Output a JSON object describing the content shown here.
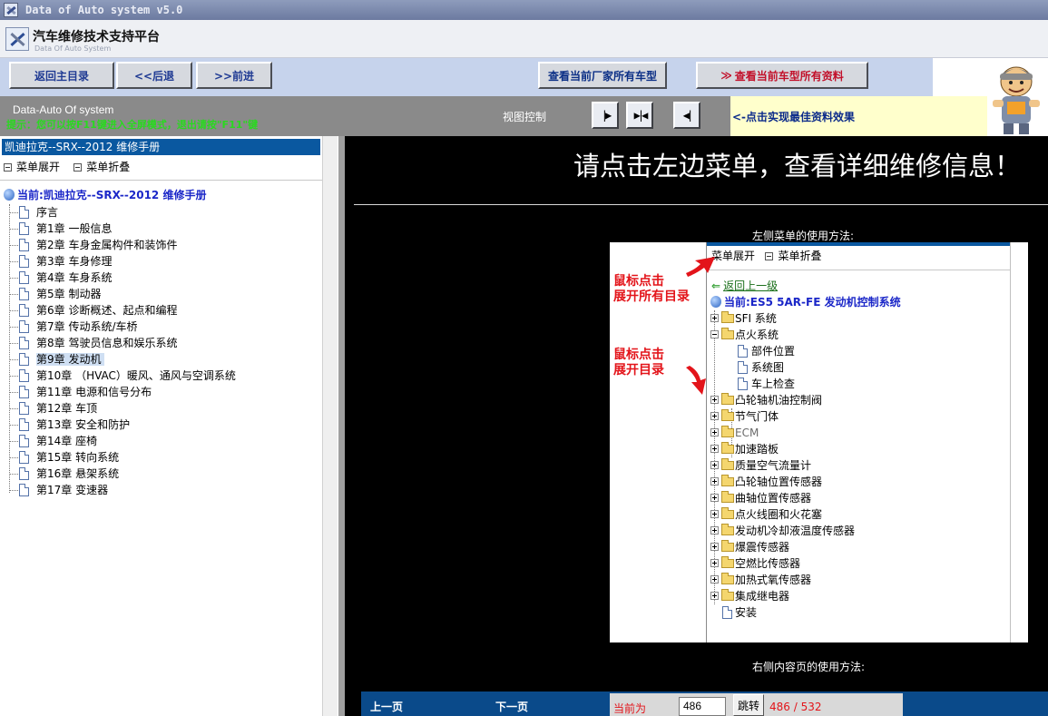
{
  "window": {
    "title": "Data of Auto system v5.0"
  },
  "header": {
    "title": "汽车维修技术支持平台",
    "subtitle": "Data Of Auto System"
  },
  "toolbar": {
    "main_menu": "返回主目录",
    "back": "<<后退",
    "forward": ">>前进",
    "all_models": "查看当前厂家所有车型",
    "all_data_prefix": "≫",
    "all_data": "查看当前车型所有资料"
  },
  "viewbar": {
    "brand": "Data-Auto Of system",
    "hint": "提示：您可以按F11键进入全屏模式，退出请按\"F11\"键",
    "view_control": "视图控制",
    "tip": "<-点击实现最佳资料效果"
  },
  "sidebar": {
    "book_title": "凯迪拉克--SRX--2012 维修手册",
    "expand": "菜单展开",
    "collapse": "菜单折叠",
    "current": "当前:凯迪拉克--SRX--2012 维修手册",
    "items": [
      {
        "label": "序言"
      },
      {
        "label": "第1章  一般信息"
      },
      {
        "label": "第2章  车身金属构件和装饰件"
      },
      {
        "label": "第3章  车身修理"
      },
      {
        "label": "第4章  车身系统"
      },
      {
        "label": "第5章  制动器"
      },
      {
        "label": "第6章  诊断概述、起点和编程"
      },
      {
        "label": "第7章  传动系统/车桥"
      },
      {
        "label": "第8章  驾驶员信息和娱乐系统"
      },
      {
        "label": "第9章  发动机",
        "selected": true
      },
      {
        "label": "第10章 （HVAC）暖风、通风与空调系统"
      },
      {
        "label": "第11章  电源和信号分布"
      },
      {
        "label": "第12章  车顶"
      },
      {
        "label": "第13章  安全和防护"
      },
      {
        "label": "第14章  座椅"
      },
      {
        "label": "第15章  转向系统"
      },
      {
        "label": "第16章  悬架系统"
      },
      {
        "label": "第17章  变速器"
      }
    ]
  },
  "main": {
    "heading": "请点击左边菜单，查看详细维修信息！",
    "left_menu_caption": "左侧菜单的使用方法:",
    "right_content_caption": "右侧内容页的使用方法:",
    "demo": {
      "expand": "菜单展开",
      "collapse": "菜单折叠",
      "up_level": "返回上一级",
      "current": "当前:ES5 5AR-FE 发动机控制系统",
      "annotation_expand_all": [
        "鼠标点击",
        "展开所有目录"
      ],
      "annotation_expand": [
        "鼠标点击",
        "展开目录"
      ],
      "tree": [
        {
          "label": "SFI 系统",
          "state": "plus"
        },
        {
          "label": "点火系统",
          "state": "minus"
        },
        {
          "label": "部件位置",
          "state": "child"
        },
        {
          "label": "系统图",
          "state": "child"
        },
        {
          "label": "车上检查",
          "state": "child"
        },
        {
          "label": "凸轮轴机油控制阀",
          "state": "plus"
        },
        {
          "label": "节气门体",
          "state": "plus"
        },
        {
          "label": "ECM",
          "state": "plus"
        },
        {
          "label": "加速踏板",
          "state": "plus"
        },
        {
          "label": "质量空气流量计",
          "state": "plus"
        },
        {
          "label": "凸轮轴位置传感器",
          "state": "plus"
        },
        {
          "label": "曲轴位置传感器",
          "state": "plus"
        },
        {
          "label": "点火线圈和火花塞",
          "state": "plus"
        },
        {
          "label": "发动机冷却液温度传感器",
          "state": "plus"
        },
        {
          "label": "爆震传感器",
          "state": "plus"
        },
        {
          "label": "空燃比传感器",
          "state": "plus"
        },
        {
          "label": "加热式氧传感器",
          "state": "plus"
        },
        {
          "label": "集成继电器",
          "state": "plus"
        },
        {
          "label": "安装",
          "state": "doc"
        }
      ]
    },
    "pager": {
      "prev": "上一页",
      "next": "下一页",
      "current_label": "当前为",
      "page_value": "486",
      "go": "跳转",
      "total": "486 / 532"
    }
  }
}
